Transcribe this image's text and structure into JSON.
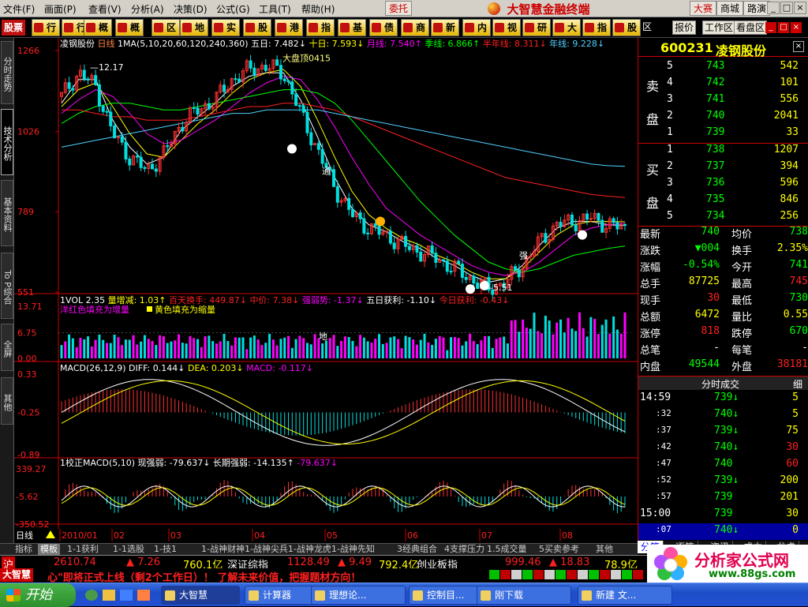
{
  "menubar": {
    "items": [
      "文件(F)",
      "画面(P)",
      "行业",
      "查看(V)",
      "分析(A)",
      "决策(D)",
      "公式(G)",
      "工具(T)",
      "帮助(H)"
    ],
    "wt_button": "委托",
    "app_title": "大智慧金融终端",
    "right_buttons": [
      "大赛",
      "商城",
      "路演"
    ],
    "win_buttons": [
      "_",
      "□",
      "×"
    ]
  },
  "toolbar": {
    "logo_text": "股票",
    "buttons": [
      "行业",
      "行业",
      "概念",
      "概念",
      "区域",
      "地域",
      "实时",
      "股指",
      "港股",
      "指数",
      "基金",
      "债券",
      "商品",
      "新闻",
      "内参",
      "视频",
      "研究",
      "大盘",
      "指南",
      "股票"
    ],
    "right_items": [
      "区",
      "报价",
      "工作区",
      "看盘区"
    ]
  },
  "left_tabs": [
    "分时走势",
    "技术分析",
    "基本资料",
    "To P综合",
    "全屏",
    "其他"
  ],
  "chart_header": {
    "name": "凌钢股份",
    "period": "日线",
    "ma_label": "1MA(5,10,20,60,120,240,360)",
    "ma_values": [
      {
        "label": "五日:",
        "value": "7.482",
        "dir": "↓",
        "color": "#ffffff"
      },
      {
        "label": "十日:",
        "value": "7.593",
        "dir": "↓",
        "color": "#ffff00"
      },
      {
        "label": "月线:",
        "value": "7.540",
        "dir": "↑",
        "color": "#ff00ff"
      },
      {
        "label": "季线:",
        "value": "6.866",
        "dir": "↑",
        "color": "#00ff00"
      },
      {
        "label": "半年线:",
        "value": "8.311",
        "dir": "↓",
        "color": "#ff2020"
      },
      {
        "label": "年线:",
        "value": "9.228",
        "dir": "↓",
        "color": "#4fd0ff"
      }
    ]
  },
  "price_axis": [
    "1266",
    "1026",
    "789",
    "551"
  ],
  "annotations": {
    "top_price": "12.17",
    "peak_label": "大盘顶0415",
    "low_price": "5.51",
    "pass_label": "通",
    "strong_label": "强",
    "month_label": "地"
  },
  "vol_header": {
    "label": "1VOL 2.35",
    "parts": [
      {
        "text": "量增减: 1.03↑",
        "color": "#ffff00"
      },
      {
        "text": "百天换手: 449.87↓",
        "color": "#ff2020"
      },
      {
        "text": "中价: 7.38↓",
        "color": "#ff2020"
      },
      {
        "text": "强弱势: -1.37↓",
        "color": "#ff00ff"
      },
      {
        "text": "五日获利: -1.10↓",
        "color": "#ffffff"
      },
      {
        "text": "今日获利: -0.43↓",
        "color": "#ff2020"
      }
    ],
    "legend1": "洋红色填充为增量",
    "legend2": "黄色填充为缩量"
  },
  "vol_axis": [
    "13.71",
    "6.75",
    "0.00"
  ],
  "macd_header": {
    "label": "MACD(26,12,9)",
    "diff": "DIFF: 0.144↓",
    "dea": "DEA: 0.203↓",
    "macd": "MACD: -0.117↓"
  },
  "macd_axis": [
    "0.33",
    "-0.25",
    "-0.89"
  ],
  "macd2_header": {
    "label": "1校正MACD(5,10)",
    "a": "现强弱: -79.637↓",
    "b": "长期强弱: -14.135↑",
    "c": "-79.637↓"
  },
  "macd2_axis": [
    "339.27",
    "-5.62",
    "-350.52"
  ],
  "time_axis": [
    "日线",
    "2010/01",
    "02",
    "03",
    "04",
    "05",
    "06",
    "07",
    "08"
  ],
  "chart_data": [
    {
      "type": "candlestick",
      "title": "凌钢股份 日线",
      "ylim": [
        5.51,
        12.66
      ],
      "x": [
        "2010/01",
        "02",
        "03",
        "04",
        "05",
        "06",
        "07",
        "08"
      ],
      "close_path": [
        11.3,
        12.0,
        11.6,
        10.2,
        9.5,
        9.1,
        9.6,
        10.5,
        10.9,
        11.2,
        11.8,
        12.1,
        12.2,
        12.0,
        10.8,
        9.7,
        8.6,
        7.8,
        7.4,
        7.2,
        6.9,
        6.7,
        6.5,
        6.2,
        5.9,
        5.6,
        5.8,
        6.3,
        7.0,
        7.5,
        7.6,
        7.7,
        7.5,
        7.4
      ],
      "series": [
        {
          "name": "五日",
          "values": [
            11.1,
            11.8,
            11.8,
            10.6,
            9.8,
            9.3,
            9.5,
            10.3,
            10.7,
            11.1,
            11.6,
            11.9,
            12.0,
            12.0,
            11.2,
            10.1,
            8.9,
            8.0,
            7.5,
            7.3,
            7.0,
            6.8,
            6.5,
            6.3,
            6.0,
            5.8,
            5.9,
            6.3,
            6.9,
            7.4,
            7.6,
            7.6,
            7.5,
            7.48
          ]
        },
        {
          "name": "十日",
          "values": [
            11.0,
            11.5,
            11.7,
            11.0,
            10.2,
            9.6,
            9.5,
            10.0,
            10.5,
            10.9,
            11.4,
            11.8,
            12.0,
            12.1,
            11.6,
            10.6,
            9.5,
            8.5,
            7.8,
            7.4,
            7.1,
            6.9,
            6.6,
            6.4,
            6.1,
            5.9,
            5.9,
            6.2,
            6.7,
            7.2,
            7.5,
            7.6,
            7.6,
            7.59
          ]
        },
        {
          "name": "月线",
          "values": [
            10.8,
            11.2,
            11.5,
            11.3,
            10.8,
            10.2,
            9.9,
            10.0,
            10.3,
            10.6,
            11.0,
            11.4,
            11.7,
            11.9,
            11.8,
            11.2,
            10.4,
            9.5,
            8.7,
            8.0,
            7.6,
            7.2,
            6.9,
            6.6,
            6.3,
            6.1,
            6.0,
            6.1,
            6.4,
            6.8,
            7.2,
            7.4,
            7.5,
            7.54
          ]
        },
        {
          "name": "季线",
          "values": [
            10.5,
            10.8,
            11.0,
            11.1,
            11.1,
            11.0,
            10.9,
            10.9,
            11.0,
            11.1,
            11.2,
            11.3,
            11.4,
            11.5,
            11.5,
            11.4,
            11.1,
            10.6,
            10.0,
            9.4,
            8.8,
            8.2,
            7.7,
            7.2,
            6.8,
            6.4,
            6.2,
            6.1,
            6.2,
            6.4,
            6.6,
            6.7,
            6.8,
            6.87
          ]
        },
        {
          "name": "半年线",
          "values": [
            10.9,
            10.9,
            10.8,
            10.7,
            10.7,
            10.6,
            10.6,
            10.6,
            10.7,
            10.8,
            10.9,
            11.0,
            11.0,
            11.1,
            11.1,
            11.0,
            10.9,
            10.7,
            10.5,
            10.3,
            10.1,
            9.9,
            9.7,
            9.5,
            9.3,
            9.1,
            8.9,
            8.8,
            8.7,
            8.6,
            8.5,
            8.4,
            8.35,
            8.31
          ]
        },
        {
          "name": "年线",
          "values": [
            9.8,
            9.9,
            10.0,
            10.1,
            10.2,
            10.3,
            10.4,
            10.5,
            10.6,
            10.7,
            10.8,
            10.8,
            10.9,
            10.9,
            10.9,
            10.9,
            10.8,
            10.7,
            10.6,
            10.5,
            10.4,
            10.3,
            10.2,
            10.1,
            10.0,
            9.9,
            9.8,
            9.7,
            9.6,
            9.5,
            9.4,
            9.3,
            9.25,
            9.23
          ]
        }
      ]
    }
  ],
  "quote": {
    "code": "600231",
    "name": "凌钢股份",
    "sell_label": [
      "卖",
      "盘"
    ],
    "buy_label": [
      "买",
      "盘"
    ],
    "sell": [
      {
        "lvl": "5",
        "price": "743",
        "vol": "542"
      },
      {
        "lvl": "4",
        "price": "742",
        "vol": "101"
      },
      {
        "lvl": "3",
        "price": "741",
        "vol": "556"
      },
      {
        "lvl": "2",
        "price": "740",
        "vol": "2041"
      },
      {
        "lvl": "1",
        "price": "739",
        "vol": "33"
      }
    ],
    "buy": [
      {
        "lvl": "1",
        "price": "738",
        "vol": "1207"
      },
      {
        "lvl": "2",
        "price": "737",
        "vol": "394"
      },
      {
        "lvl": "3",
        "price": "736",
        "vol": "596"
      },
      {
        "lvl": "4",
        "price": "735",
        "vol": "846"
      },
      {
        "lvl": "5",
        "price": "734",
        "vol": "256"
      }
    ],
    "stats": [
      {
        "k1": "最新",
        "v1": "740",
        "c1": "#00ff00",
        "k2": "均价",
        "v2": "738",
        "c2": "#00ff00"
      },
      {
        "k1": "涨跌",
        "v1": "▼004",
        "c1": "#00ff00",
        "k2": "换手",
        "v2": "2.35%",
        "c2": "#ffff00"
      },
      {
        "k1": "涨幅",
        "v1": "-0.54%",
        "c1": "#00ff00",
        "k2": "今开",
        "v2": "741",
        "c2": "#00ff00"
      },
      {
        "k1": "总手",
        "v1": "87725",
        "c1": "#ffff00",
        "k2": "最高",
        "v2": "745",
        "c2": "#ff2020"
      },
      {
        "k1": "现手",
        "v1": "30",
        "c1": "#ff2020",
        "k2": "最低",
        "v2": "730",
        "c2": "#00ff00"
      },
      {
        "k1": "总额",
        "v1": "6472",
        "c1": "#ffff00",
        "k2": "量比",
        "v2": "0.55",
        "c2": "#ffff00"
      },
      {
        "k1": "涨停",
        "v1": "818",
        "c1": "#ff2020",
        "k2": "跌停",
        "v2": "670",
        "c2": "#00ff00"
      },
      {
        "k1": "总笔",
        "v1": "-",
        "c1": "#ffffff",
        "k2": "每笔",
        "v2": "-",
        "c2": "#ffffff"
      },
      {
        "k1": "内盘",
        "v1": "49544",
        "c1": "#00ff00",
        "k2": "外盘",
        "v2": "38181",
        "c2": "#ff2020"
      }
    ],
    "ticks_title": "分时成交",
    "ticks_btn": "细",
    "ticks": [
      {
        "t": "14:59",
        "p": "739",
        "a": "↓",
        "v": "5",
        "vc": "#ffff00"
      },
      {
        "t": ":32",
        "p": "740",
        "a": "↓",
        "v": "5",
        "vc": "#ffff00"
      },
      {
        "t": ":37",
        "p": "739",
        "a": "↓",
        "v": "75",
        "vc": "#ffff00"
      },
      {
        "t": ":42",
        "p": "740",
        "a": "↓",
        "v": "30",
        "vc": "#ff2020"
      },
      {
        "t": ":47",
        "p": "740",
        "a": "",
        "v": "60",
        "vc": "#ff2020"
      },
      {
        "t": ":52",
        "p": "739",
        "a": "↓",
        "v": "200",
        "vc": "#ffff00"
      },
      {
        "t": ":57",
        "p": "739",
        "a": "",
        "v": "201",
        "vc": "#ffff00"
      },
      {
        "t": "15:00",
        "p": "739",
        "a": "",
        "v": "30",
        "vc": "#ffff00"
      },
      {
        "t": ":07",
        "p": "740",
        "a": "↓",
        "v": "0",
        "vc": "#ffff00"
      }
    ],
    "right_tabs": [
      "分笔",
      "逐笔",
      "资讯",
      "成本",
      "龙虎"
    ]
  },
  "bottom_tabs": [
    "指标",
    "模板",
    "1-1获利",
    "1-1选股",
    "1-技1",
    "1-战神财神1-战神尖兵1-战神龙虎1-战神先知",
    "3经典组合",
    "4支撑压力",
    "1.5成交量",
    "5买卖参考",
    "其他"
  ],
  "indexbar": {
    "sh_label": "沪",
    "sh_val": "2610.74",
    "sh_chg": "▲ 7.26",
    "sh_amt": "760.1亿",
    "sz_label": "深证综指",
    "sz_val": "1128.49",
    "sz_chg": "▲ 9.49",
    "sz_amt": "792.4亿",
    "cy_label": "创业板指",
    "cy_val": "999.46",
    "cy_chg": "▲ 18.83",
    "cy_amt": "78.9亿",
    "marquee_logo": "大智慧",
    "marquee_text": "心\"即将正式上线（剩2个工作日）！ 了解未来价值，把握题材方向！"
  },
  "taskbar": {
    "start": "开始",
    "tasks": [
      "大智慧",
      "计算器",
      "理想论...",
      "控制目...",
      "刚下载",
      "新建 文..."
    ]
  },
  "watermark": {
    "main": "分析家公式网",
    "sub": "www.88gs.com"
  }
}
